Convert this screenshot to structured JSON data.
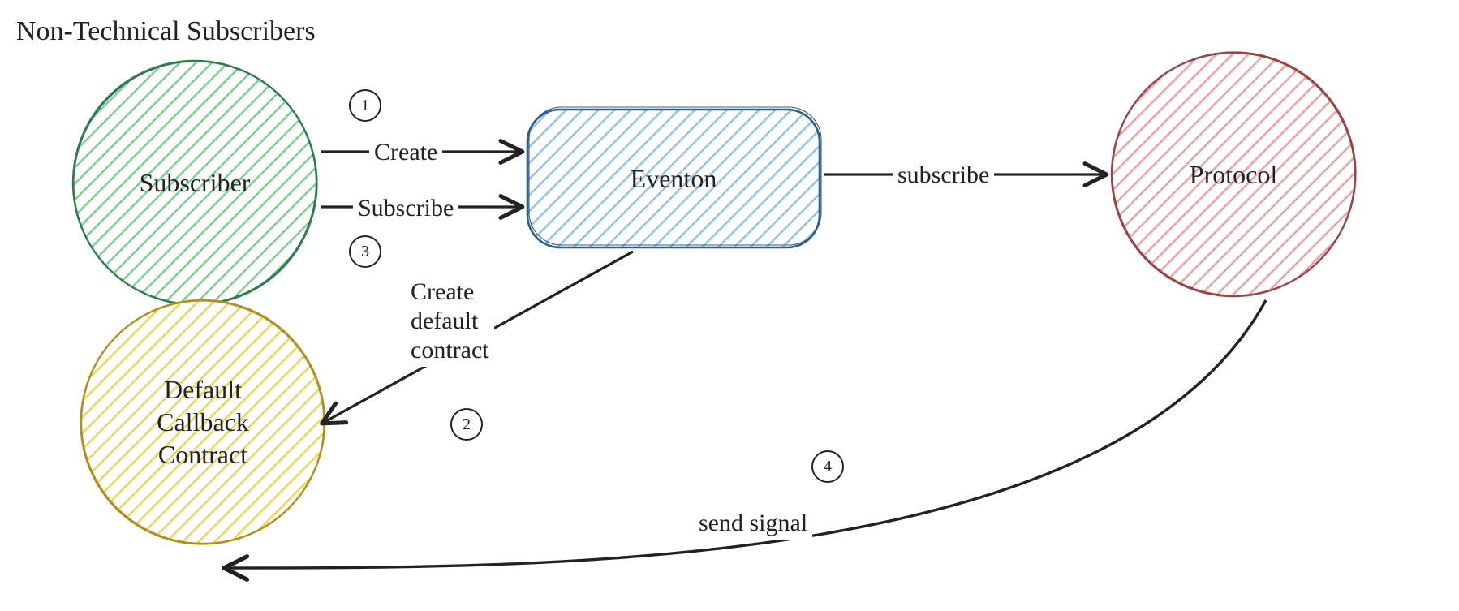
{
  "title": "Non-Technical Subscribers",
  "nodes": {
    "subscriber": {
      "label": "Subscriber",
      "color": "#7bd389"
    },
    "callback": {
      "label": "Default\nCallback\nContract",
      "color": "#f2d35b"
    },
    "eventon": {
      "label": "Eventon",
      "color": "#8fc6ef"
    },
    "protocol": {
      "label": "Protocol",
      "color": "#f2a1a1"
    }
  },
  "edges": {
    "create": {
      "label": "Create"
    },
    "subscribe_inner": {
      "label": "Subscribe"
    },
    "create_default": {
      "label": "Create\ndefault\ncontract"
    },
    "subscribe_outer": {
      "label": "subscribe"
    },
    "send_signal": {
      "label": "send signal"
    }
  },
  "steps": {
    "s1": "1",
    "s2": "2",
    "s3": "3",
    "s4": "4"
  }
}
